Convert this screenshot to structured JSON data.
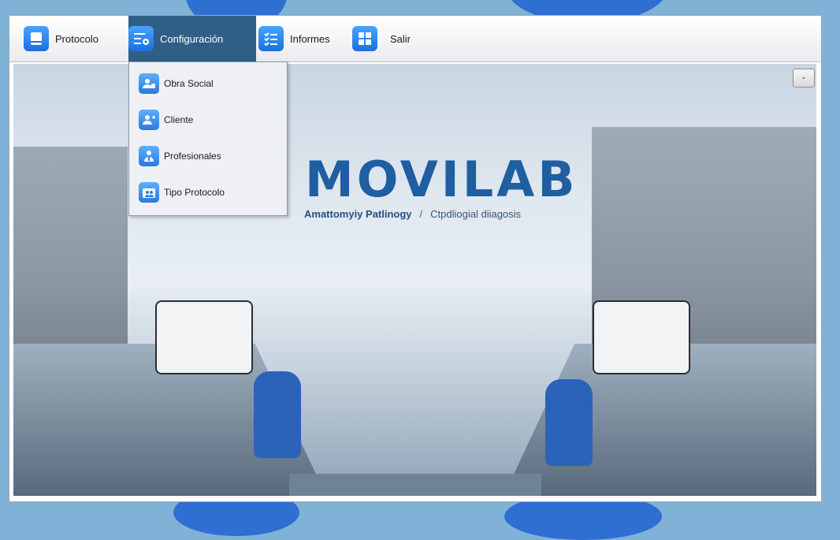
{
  "menubar": {
    "items": [
      {
        "label": "Protocolo",
        "icon": "document-icon"
      },
      {
        "label": "Configuración",
        "icon": "settings-list-icon",
        "active": true
      },
      {
        "label": "Informes",
        "icon": "checklist-icon"
      },
      {
        "label": "Salir",
        "icon": "grid-icon"
      }
    ]
  },
  "dropdown": {
    "items": [
      {
        "label": "Obra Social",
        "icon": "user-card-icon"
      },
      {
        "label": "Cliente",
        "icon": "user-add-icon"
      },
      {
        "label": "Profesionales",
        "icon": "professional-icon"
      },
      {
        "label": "Tipo Protocolo",
        "icon": "users-folder-icon"
      }
    ]
  },
  "content": {
    "logo_title": "MOVILAB",
    "logo_subtitle_a": "Amattomyiy Patlinogy",
    "logo_separator": "/",
    "logo_subtitle_b": "Ctpdliogial diiagosis",
    "minimize_label": "-"
  },
  "colors": {
    "active_menu_bg": "#2f5f86",
    "icon_blue": "#1c6fe0",
    "logo_blue": "#1f5ea0"
  }
}
